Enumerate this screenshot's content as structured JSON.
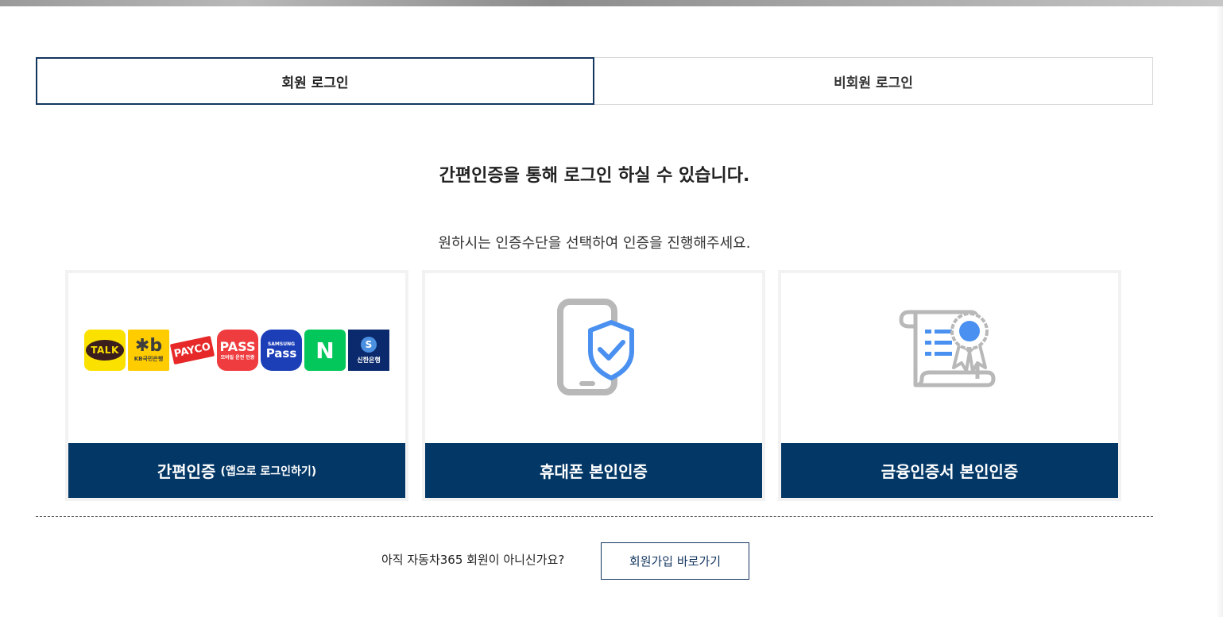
{
  "tabs": {
    "member_login": "회원 로그인",
    "guest_login": "비회원 로그인"
  },
  "main": {
    "headline": "간편인증을 통해 로그인 하실 수 있습니다.",
    "subline": "원하시는 인증수단을 선택하여 인증을 진행해주세요."
  },
  "cards": {
    "simple": {
      "label": "간편인증",
      "sublabel": "(앱으로 로그인하기)",
      "logos": {
        "kakao": "TALK",
        "kb_mark": "✱b",
        "kb_text": "KB국민은행",
        "payco": "PAYCO",
        "pass": "PASS",
        "pass_sub": "모바일 운전 인증",
        "samsung_top": "SAMSUNG",
        "samsung_pass": "Pass",
        "naver": "N",
        "shinhan_mark": "S",
        "shinhan_text": "신한은행"
      }
    },
    "phone": {
      "label": "휴대폰 본인인증"
    },
    "cert": {
      "label": "금융인증서 본인인증"
    }
  },
  "footer": {
    "prompt": "아직 자동차365 회원이 아니신가요?",
    "signup_button": "회원가입 바로가기"
  },
  "colors": {
    "navy": "#033766",
    "tab_border": "#13365f",
    "shield_blue": "#4a90f0",
    "icon_gray": "#b8b8b8"
  }
}
